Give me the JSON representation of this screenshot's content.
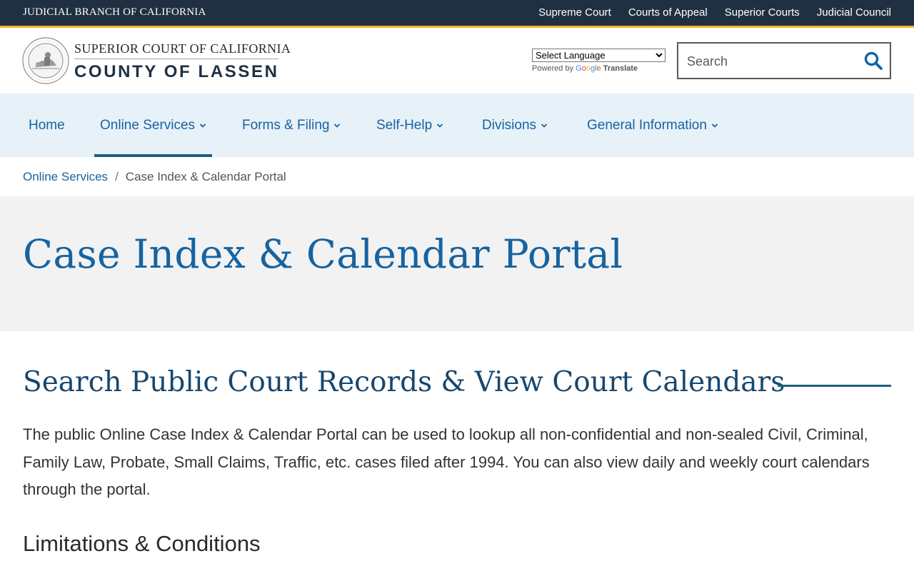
{
  "topbar": {
    "branch": "JUDICIAL BRANCH OF CALIFORNIA",
    "links": [
      "Supreme Court",
      "Courts of Appeal",
      "Superior Courts",
      "Judicial Council"
    ]
  },
  "brand": {
    "line1": "SUPERIOR COURT OF CALIFORNIA",
    "line2": "COUNTY OF LASSEN"
  },
  "translate": {
    "select_value": "Select Language",
    "powered_by": "Powered by",
    "google": "Google",
    "translate": "Translate"
  },
  "search": {
    "placeholder": "Search"
  },
  "nav": {
    "items": [
      {
        "label": "Home",
        "has_menu": false,
        "active": false
      },
      {
        "label": "Online Services",
        "has_menu": true,
        "active": true
      },
      {
        "label": "Forms & Filing",
        "has_menu": true,
        "active": false
      },
      {
        "label": "Self-Help",
        "has_menu": true,
        "active": false
      },
      {
        "label": "Divisions",
        "has_menu": true,
        "active": false
      },
      {
        "label": "General Information",
        "has_menu": true,
        "active": false
      }
    ]
  },
  "breadcrumb": {
    "parent": "Online Services",
    "separator": "/",
    "current": "Case Index & Calendar Portal"
  },
  "page": {
    "title": "Case Index & Calendar Portal",
    "section_title": "Search Public Court Records & View Court Calendars",
    "intro": "The public Online Case Index & Calendar Portal can be used to lookup all non-confidential and non-sealed Civil, Criminal, Family Law, Probate, Small Claims, Traffic, etc. cases filed after 1994. You can also view daily and weekly court calendars through the portal.",
    "subheading": "Limitations & Conditions"
  },
  "colors": {
    "topbar": "#1f3042",
    "accent": "#f1b52c",
    "link": "#1763a0",
    "nav_bg": "#e7f1f8",
    "hero_bg": "#f2f2f2"
  },
  "icons": {
    "search": "search-icon",
    "chevron": "chevron-down-icon",
    "seal": "court-seal-icon"
  }
}
